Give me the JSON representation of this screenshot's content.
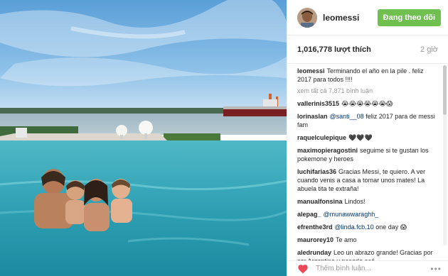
{
  "post": {
    "username": "leomessi",
    "follow_label": "Đang theo dõi",
    "likes": "1,016,778 lượt thích",
    "time_ago": "2 giờ",
    "caption_user": "leomessi",
    "caption_text": "Terminando el año en la pile . feliz 2017 para todos !!!!",
    "view_all_comments": "xem tất cả 7,871 bình luận",
    "add_comment_placeholder": "Thêm bình luận...",
    "more_options": "•••"
  },
  "comments": [
    {
      "user": "vallerinis3515",
      "text": "😭😭😭😭😭😭😱"
    },
    {
      "user": "lorinaslan",
      "mention": "@santi__08",
      "text": " feliz 2017 para de messi fam"
    },
    {
      "user": "raquelculepique",
      "text": "🖤🖤🖤"
    },
    {
      "user": "maximopieragostini",
      "text": "seguime si te gustan los pokemone y heroes"
    },
    {
      "user": "luchifarias36",
      "text": "Gracias Messi, te quiero. A ver cuando venis a casa a tomar unos mates! La abuela tita te extraña!"
    },
    {
      "user": "manualfonsina",
      "text": "Lindos!"
    },
    {
      "user": "alepag_",
      "mention": "@munawwaraghh_",
      "text": ""
    },
    {
      "user": "efrenthe3rd",
      "mention": "@linda.fcb.10",
      "text": " one day 😱"
    },
    {
      "user": "maurorey10",
      "text": "Te amo"
    },
    {
      "user": "aledrunday",
      "text": "Leo un abrazo grande! Gracias por ser Argentino y pasarla acá"
    }
  ],
  "colors": {
    "follow_green": "#70c050",
    "heart_red": "#ed4956",
    "mention_blue": "#003569",
    "muted_gray": "#999999"
  },
  "icons": [
    "avatar",
    "heart-icon"
  ]
}
